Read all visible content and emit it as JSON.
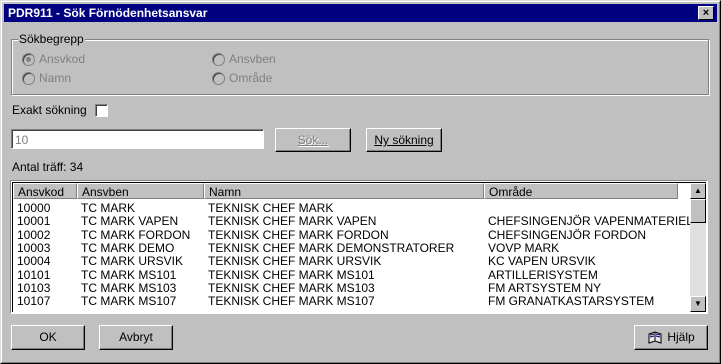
{
  "window": {
    "title": "PDR911 - Sök Förnödenhetsansvar",
    "close_glyph": "×"
  },
  "search_terms": {
    "legend": "Sökbegrepp",
    "options": [
      {
        "label": "Ansvkod",
        "selected": true
      },
      {
        "label": "Namn",
        "selected": false
      },
      {
        "label": "Ansvben",
        "selected": false
      },
      {
        "label": "Område",
        "selected": false
      }
    ]
  },
  "exact_search": {
    "label": "Exakt sökning",
    "checked": false
  },
  "search_input": {
    "value": "10"
  },
  "buttons": {
    "search": "Sök...",
    "new_search": "Ny sökning",
    "ok": "OK",
    "cancel": "Avbryt",
    "help": "Hjälp"
  },
  "hit_count": "Antal träff: 34",
  "table": {
    "columns": [
      "Ansvkod",
      "Ansvben",
      "Namn",
      "Område"
    ],
    "rows": [
      [
        "10000",
        "TC MARK",
        "TEKNISK CHEF MARK",
        ""
      ],
      [
        "10001",
        "TC MARK VAPEN",
        "TEKNISK CHEF MARK VAPEN",
        "CHEFSINGENJÖR VAPENMATERIEL"
      ],
      [
        "10002",
        "TC MARK FORDON",
        "TEKNISK CHEF MARK FORDON",
        "CHEFSINGENJÖR FORDON"
      ],
      [
        "10003",
        "TC MARK DEMO",
        "TEKNISK CHEF MARK DEMONSTRATORER",
        "VOVP MARK"
      ],
      [
        "10004",
        "TC MARK URSVIK",
        "TEKNISK CHEF MARK URSVIK",
        "KC VAPEN URSVIK"
      ],
      [
        "10101",
        "TC MARK MS101",
        "TEKNISK CHEF MARK MS101",
        "ARTILLERISYSTEM"
      ],
      [
        "10103",
        "TC MARK MS103",
        "TEKNISK CHEF MARK MS103",
        "FM ARTSYSTEM NY"
      ],
      [
        "10107",
        "TC MARK MS107",
        "TEKNISK CHEF MARK MS107",
        "FM GRANATKASTARSYSTEM"
      ]
    ]
  },
  "icons": {
    "help": "help-book-icon",
    "scroll_up": "arrow-up-icon",
    "scroll_down": "arrow-down-icon"
  }
}
